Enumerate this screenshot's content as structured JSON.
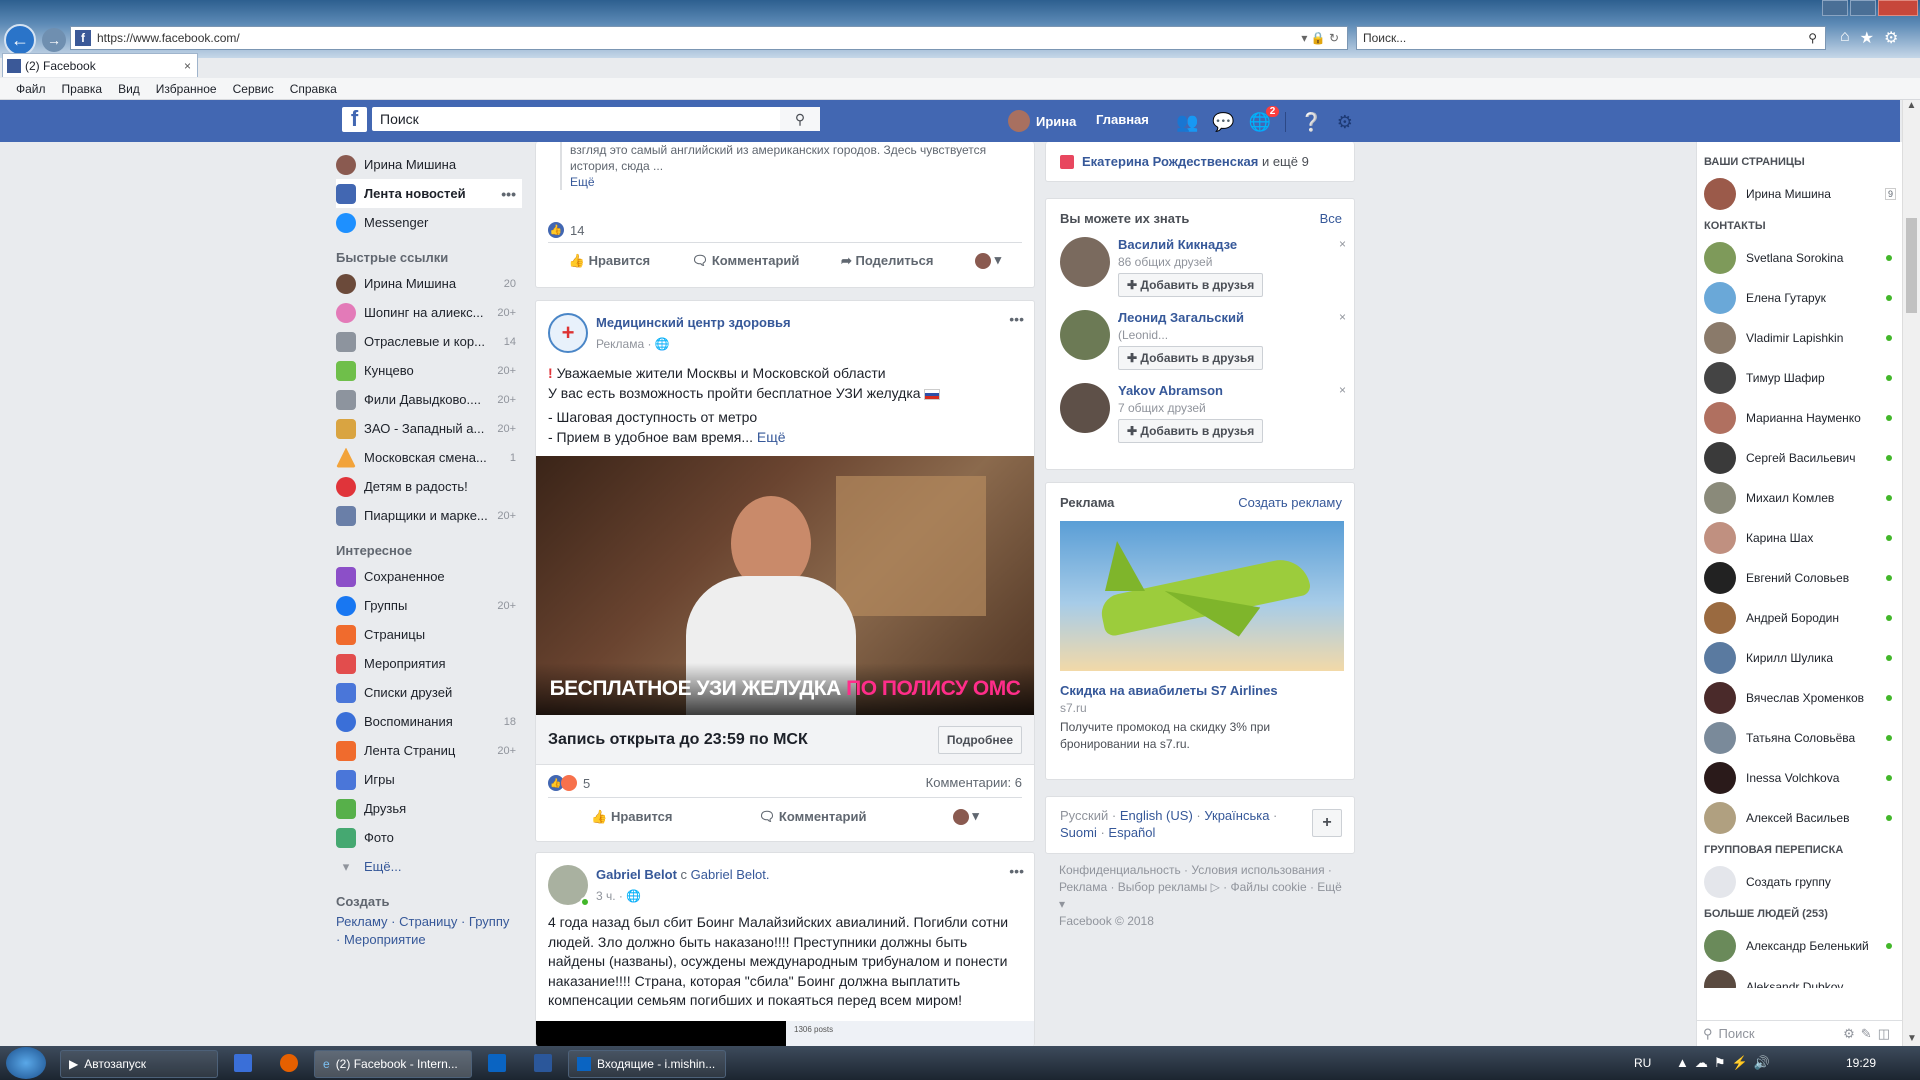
{
  "browser": {
    "url": "https://www.facebook.com/",
    "search_placeholder": "Поиск...",
    "tab_title": "(2) Facebook",
    "menu": [
      "Файл",
      "Правка",
      "Вид",
      "Избранное",
      "Сервис",
      "Справка"
    ]
  },
  "fb_header": {
    "search_placeholder": "Поиск",
    "user_name": "Ирина",
    "home_label": "Главная",
    "notif_badge": "2"
  },
  "left_sidebar": {
    "profile_name": "Ирина Мишина",
    "primary": [
      {
        "label": "Лента новостей",
        "count": ""
      },
      {
        "label": "Messenger",
        "count": ""
      }
    ],
    "shortcuts_heading": "Быстрые ссылки",
    "shortcuts": [
      {
        "label": "Ирина Мишина",
        "count": "20"
      },
      {
        "label": "Шопинг на алиекс...",
        "count": "20+"
      },
      {
        "label": "Отраслевые и кор...",
        "count": "14"
      },
      {
        "label": "Кунцево",
        "count": "20+"
      },
      {
        "label": "Фили Давыдково....",
        "count": "20+"
      },
      {
        "label": "ЗАО - Западный а...",
        "count": "20+"
      },
      {
        "label": "Московская смена...",
        "count": "1"
      },
      {
        "label": "Детям в радость!",
        "count": ""
      },
      {
        "label": "Пиарщики и марке...",
        "count": "20+"
      }
    ],
    "explore_heading": "Интересное",
    "explore": [
      {
        "label": "Сохраненное",
        "count": ""
      },
      {
        "label": "Группы",
        "count": "20+"
      },
      {
        "label": "Страницы",
        "count": ""
      },
      {
        "label": "Мероприятия",
        "count": ""
      },
      {
        "label": "Списки друзей",
        "count": ""
      },
      {
        "label": "Воспоминания",
        "count": "18"
      },
      {
        "label": "Лента Страниц",
        "count": "20+"
      },
      {
        "label": "Игры",
        "count": ""
      },
      {
        "label": "Друзья",
        "count": ""
      },
      {
        "label": "Фото",
        "count": ""
      }
    ],
    "more": "Ещё...",
    "create_heading": "Создать",
    "create_links": [
      "Рекламу",
      "Страницу",
      "Группу",
      "Мероприятие"
    ]
  },
  "feed": {
    "post0": {
      "text": "взгляд это самый английский из американских городов. Здесь чувствуется история, сюда ...",
      "more": "Ещё",
      "likes": "14",
      "actions": [
        "Нравится",
        "Комментарий",
        "Поделиться"
      ]
    },
    "post1": {
      "author": "Медицинский центр здоровья",
      "subtitle": "Реклама",
      "line1": "Уважаемые жители Москвы и Московской области",
      "line2": "У вас есть возможность пройти бесплатное УЗИ желудка",
      "line3": "- Шаговая доступность от метро",
      "line4": "- Прием в удобное вам время...",
      "more": "Ещё",
      "banner_white": "БЕСПЛАТНОЕ УЗИ ЖЕЛУДКА",
      "banner_pink": "ПО ПОЛИСУ ОМС",
      "cta_text": "Запись открыта до 23:59 по МСК",
      "cta_button": "Подробнее",
      "reactions": "5",
      "comments": "Комментарии: 6",
      "actions": [
        "Нравится",
        "Комментарий"
      ]
    },
    "post2": {
      "author": "Gabriel Belot",
      "with": "с",
      "with_name": "Gabriel Belot.",
      "time": "3 ч.",
      "text": "4 года назад был сбит Боинг Малайзийских авиалиний. Погибли сотни людей. Зло должно быть наказано!!!! Преступники должны быть найдены (названы), осуждены международным трибуналом и понести наказание!!!! Страна, которая \"сбила\" Боинг должна выплатить компенсации семьям погибших и покаяться перед всем миром!",
      "preview_label": "1306 posts"
    }
  },
  "right_col": {
    "birthday_text": "Екатерина Рождественская",
    "birthday_suffix": "и ещё 9",
    "pymk_title": "Вы можете их знать",
    "pymk_all": "Все",
    "pymk": [
      {
        "name": "Василий Кикнадзе",
        "sub": "86 общих друзей"
      },
      {
        "name": "Леонид Загальский",
        "sub": "(Leonid..."
      },
      {
        "name": "Yakov Abramson",
        "sub": "7 общих друзей"
      }
    ],
    "add_friend": "Добавить в друзья",
    "ads_title": "Реклама",
    "ads_create": "Создать рекламу",
    "ad_title": "Скидка на авиабилеты S7 Airlines",
    "ad_domain": "s7.ru",
    "ad_text": "Получите промокод на скидку 3% при бронировании на s7.ru.",
    "langs_current": "Русский",
    "langs": [
      "English (US)",
      "Українська",
      "Suomi",
      "Español"
    ],
    "footer_links": "Конфиденциальность · Условия использования · Реклама · Выбор рекламы ▷ · Файлы cookie · Ещё ▾",
    "copyright": "Facebook © 2018"
  },
  "chat_sidebar": {
    "pages_heading": "ВАШИ СТРАНИЦЫ",
    "page_name": "Ирина Мишина",
    "page_count": "9",
    "contacts_heading": "КОНТАКТЫ",
    "contacts": [
      "Svetlana Sorokina",
      "Елена Гутарук",
      "Vladimir Lapishkin",
      "Тимур Шафир",
      "Марианна Науменко",
      "Сергей Васильевич",
      "Михаил Комлев",
      "Карина Шах",
      "Евгений Соловьев",
      "Андрей Бородин",
      "Кирилл Шулика",
      "Вячеслав Хроменков",
      "Татьяна Соловьёва",
      "Inessa Volchkova",
      "Алексей Васильев"
    ],
    "group_heading": "ГРУППОВАЯ ПЕРЕПИСКА",
    "create_group": "Создать группу",
    "more_heading": "БОЛЬШЕ ЛЮДЕЙ (253)",
    "more_people": [
      "Александр Беленький",
      "Aleksandr Dubkov"
    ],
    "search_placeholder": "Поиск"
  },
  "taskbar": {
    "items": [
      "Автозапуск",
      "(2) Facebook - Intern...",
      "Входящие - i.mishin..."
    ],
    "lang": "RU",
    "time": "19:29"
  },
  "colors": {
    "fb_blue": "#4267b2",
    "link": "#365899",
    "online": "#42b72a",
    "banner_pink": "#ff2d8a"
  }
}
